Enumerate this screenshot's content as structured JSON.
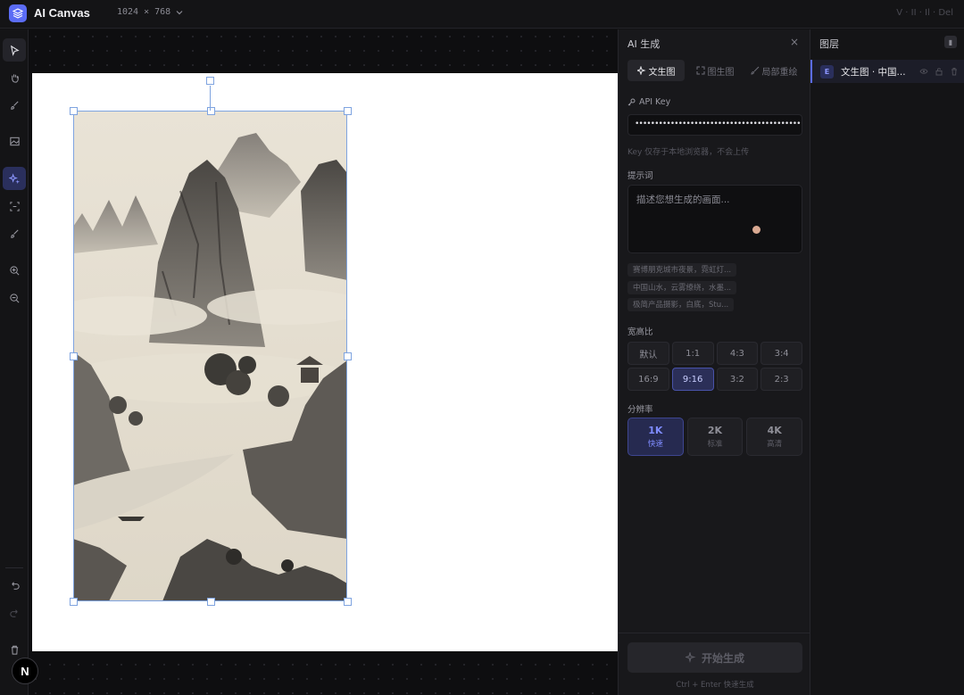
{
  "app": {
    "title": "AI Canvas",
    "canvas_size": "1024 × 768",
    "version": "V · II · Il · Del"
  },
  "toolbar": {
    "tools": [
      "select-tool",
      "hand-tool",
      "brush-tool",
      "image-tool",
      "ai-tool",
      "crop-tool",
      "brush-alt-tool",
      "zoom-in-tool",
      "zoom-out-tool"
    ],
    "bottom": [
      "undo-tool",
      "redo-tool",
      "delete-tool"
    ]
  },
  "ai_panel": {
    "title": "AI 生成",
    "close": "×",
    "tabs": [
      {
        "label": "文生图",
        "active": true
      },
      {
        "label": "图生图",
        "active": false
      },
      {
        "label": "局部重绘",
        "active": false
      }
    ],
    "api_key_label": "API Key",
    "api_key_value": "••••••••••••••••••••••••••••••••••••••••••••••",
    "api_key_hint": "Key 仅存于本地浏览器，不会上传",
    "prompt_label": "提示词",
    "prompt_placeholder": "描述您想生成的画面...",
    "suggestions": [
      "赛博朋克城市夜景，霓虹灯...",
      "中国山水，云雾缭绕，水墨...",
      "极简产品摄影，白底，Stu..."
    ],
    "ratio_label": "宽高比",
    "ratios": [
      {
        "label": "默认",
        "active": false
      },
      {
        "label": "1:1",
        "active": false
      },
      {
        "label": "4:3",
        "active": false
      },
      {
        "label": "3:4",
        "active": false
      },
      {
        "label": "16:9",
        "active": false
      },
      {
        "label": "9:16",
        "active": true
      },
      {
        "label": "3:2",
        "active": false
      },
      {
        "label": "2:3",
        "active": false
      }
    ],
    "resolution_label": "分辨率",
    "resolutions": [
      {
        "value": "1K",
        "sub": "快速",
        "active": true
      },
      {
        "value": "2K",
        "sub": "标准",
        "active": false
      },
      {
        "value": "4K",
        "sub": "高清",
        "active": false
      }
    ],
    "generate_label": "开始生成",
    "shortcut_hint": "Ctrl + Enter 快速生成"
  },
  "layers": {
    "title": "图层",
    "items": [
      {
        "name": "文生图 · 中国...",
        "thumb": "E"
      }
    ]
  },
  "colors": {
    "accent": "#5b6cf5",
    "selection": "#7fa4e0"
  }
}
